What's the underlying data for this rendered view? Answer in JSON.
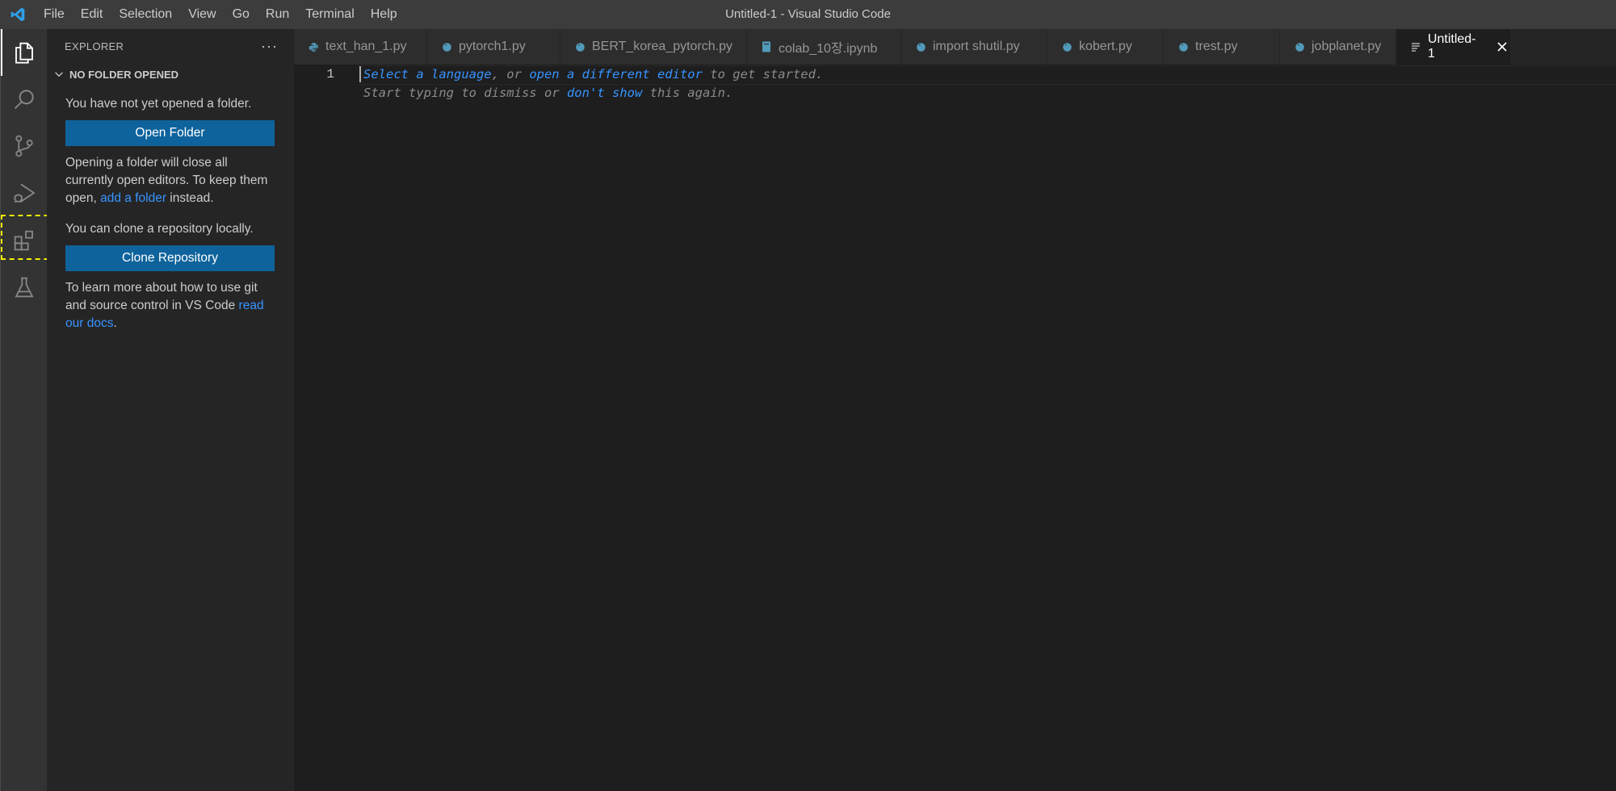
{
  "window": {
    "title": "Untitled-1 - Visual Studio Code"
  },
  "menu": [
    "File",
    "Edit",
    "Selection",
    "View",
    "Go",
    "Run",
    "Terminal",
    "Help"
  ],
  "activity_bar": {
    "items": [
      "explorer-icon",
      "search-icon",
      "source-control-icon",
      "run-debug-icon",
      "extensions-icon",
      "testing-icon"
    ],
    "active": "explorer-icon",
    "highlighted": "extensions-icon"
  },
  "sidebar": {
    "header": "EXPLORER",
    "more": "···",
    "section_title": "NO FOLDER OPENED",
    "msg_not_opened": "You have not yet opened a folder.",
    "open_folder_btn": "Open Folder",
    "msg_opening_1": "Opening a folder will close all currently open editors. To keep them open, ",
    "msg_opening_link": "add a folder",
    "msg_opening_2": " instead.",
    "msg_clone": "You can clone a repository locally.",
    "clone_btn": "Clone Repository",
    "msg_learn_1": "To learn more about how to use git and source control in VS Code ",
    "msg_learn_link": "read our docs",
    "msg_learn_2": "."
  },
  "tabs": [
    {
      "label": "text_han_1.py",
      "icon": "python-icon"
    },
    {
      "label": "pytorch1.py",
      "icon": "python-icon"
    },
    {
      "label": "BERT_korea_pytorch.py",
      "icon": "python-icon"
    },
    {
      "label": "colab_10장.ipynb",
      "icon": "notebook-icon"
    },
    {
      "label": "import shutil.py",
      "icon": "python-icon"
    },
    {
      "label": "kobert.py",
      "icon": "python-icon"
    },
    {
      "label": "trest.py",
      "icon": "python-icon"
    },
    {
      "label": "jobplanet.py",
      "icon": "python-icon"
    },
    {
      "label": "Untitled-1",
      "icon": "text-file-icon",
      "active": true
    }
  ],
  "editor": {
    "line_number": "1",
    "hint1_link1": "Select a language",
    "hint1_mid": ", or ",
    "hint1_link2": "open a different editor",
    "hint1_end": " to get started.",
    "hint2_start": "Start typing to dismiss or ",
    "hint2_link": "don't show",
    "hint2_end": " this again."
  },
  "colors": {
    "accent": "#0e639c",
    "link": "#3794ff",
    "highlight_box": "#f5f000",
    "python_icon": "#519aba"
  }
}
